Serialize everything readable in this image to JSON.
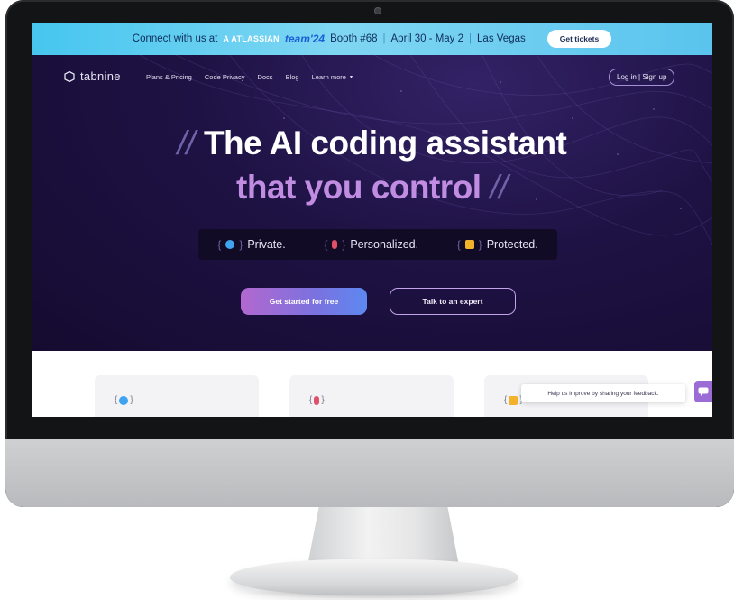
{
  "banner": {
    "lead": "Connect with us at",
    "atlassian": "A ATLASSIAN",
    "team": "team'24",
    "booth": "Booth #68",
    "dates": "April 30 - May 2",
    "location": "Las Vegas",
    "cta": "Get tickets"
  },
  "nav": {
    "brand": "tabnine",
    "links": [
      "Plans & Pricing",
      "Code Privacy",
      "Docs",
      "Blog",
      "Learn more"
    ],
    "login": "Log in | Sign up"
  },
  "hero": {
    "line1": "The AI coding assistant",
    "line2": "that you control",
    "slash": "//",
    "values": [
      "Private.",
      "Personalized.",
      "Protected."
    ]
  },
  "cta": {
    "primary": "Get started for free",
    "secondary": "Talk to an expert"
  },
  "feedback": {
    "prompt": "Help us improve by sharing your feedback."
  },
  "colors": {
    "banner": "#46c6ef",
    "hero_bg": "#1a0f36",
    "accent_purple": "#c08de2",
    "chip_blue": "#3fa3f0",
    "chip_red": "#e05068",
    "chip_yellow": "#f2b32a"
  }
}
